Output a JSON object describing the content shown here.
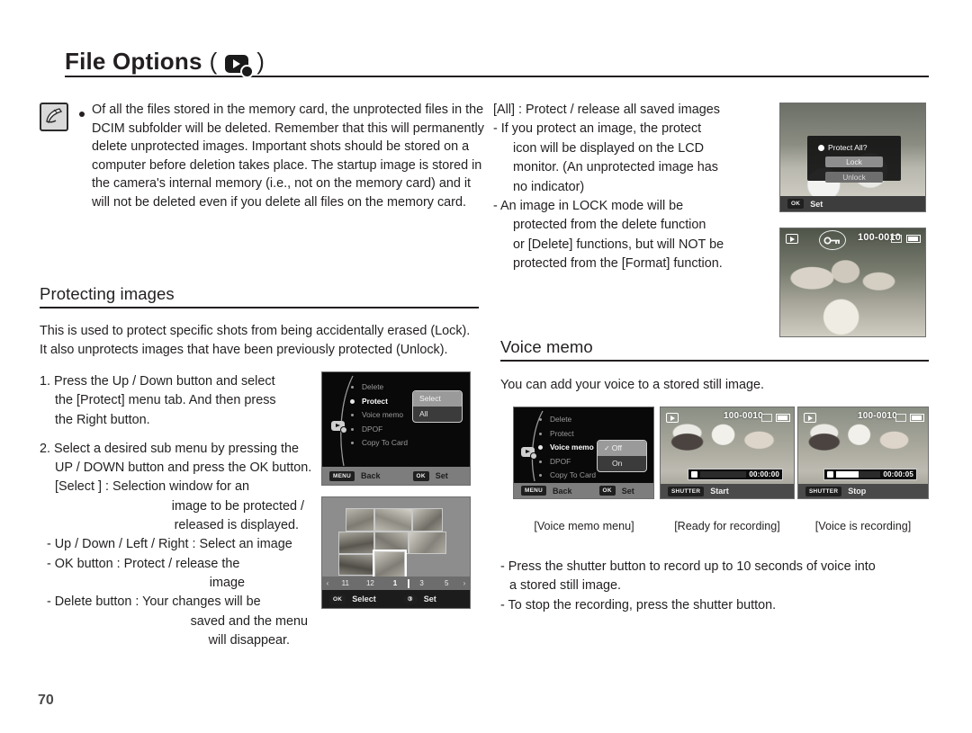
{
  "header": {
    "title": "File Options",
    "paren_open": "(",
    "paren_close": ")",
    "icon": "play-mode-icon"
  },
  "note": {
    "icon": "pen-note-icon",
    "bullet": "•",
    "text": "Of all the files stored in the memory card, the unprotected files in the DCIM subfolder will be deleted. Remember that this will permanently delete unprotected images. Important shots should be stored on a computer before deletion takes place. The startup image is stored in the camera's internal memory (i.e., not on the memory card) and it will not be deleted even if you delete all files on the memory card."
  },
  "right_notes": {
    "lines": [
      "[All] : Protect / release all saved images",
      "- If you protect an image, the protect",
      "icon will be displayed on the LCD",
      "monitor. (An unprotected image has",
      "no indicator)",
      "- An image in LOCK mode will be",
      "protected from the delete function",
      "or [Delete] functions, but will NOT be",
      "protected from the [Format] function."
    ]
  },
  "protecting_images": {
    "heading": "Protecting images",
    "intro_line_1": "This is used to protect specific shots from being accidentally erased (Lock).",
    "intro_line_2": "It also unprotects images that have been previously protected (Unlock).",
    "step1": [
      "1. Press the Up / Down button and select",
      "the [Protect] menu tab. And then press",
      "the Right button."
    ],
    "step2": [
      "2. Select a desired sub menu by pressing the",
      "UP / DOWN button and press the OK button.",
      "[Select ] : Selection window for an",
      "image to be protected /",
      "released is displayed.",
      "- Up / Down / Left / Right : Select an image",
      "- OK button : Protect / release the",
      "image",
      "- Delete button : Your changes will be",
      "saved and the menu",
      "will disappear."
    ]
  },
  "voice_memo": {
    "heading": "Voice memo",
    "intro": "You can add your voice to a stored still image.",
    "bullets": [
      "- Press the shutter button to record up to 10 seconds of voice into",
      "a stored still image.",
      "- To stop the recording, press the shutter button."
    ],
    "captions": [
      "[Voice memo menu]",
      "[Ready for recording]",
      "[Voice is recording]"
    ]
  },
  "lcd_protect_menu": {
    "items": [
      "Delete",
      "Protect",
      "Voice memo",
      "DPOF",
      "Copy To Card"
    ],
    "selected_index": 1,
    "submenu": [
      "Select",
      "All"
    ],
    "submenu_active_index": 0,
    "bar": {
      "left_key": "MENU",
      "left_label": "Back",
      "right_key": "OK",
      "right_label": "Set"
    },
    "mode_icon": "play-mode-icon"
  },
  "lcd_thumbnails": {
    "page_numbers": [
      "11",
      "12",
      "1",
      "3",
      "5"
    ],
    "current_page": "1",
    "arrow_left": "‹",
    "arrow_right": "›",
    "bar": {
      "left_key": "OK",
      "left_label": "Select",
      "right_key": "③",
      "right_label": "Set"
    }
  },
  "lcd_protect_all": {
    "title": "Protect All?",
    "buttons": [
      "Lock",
      "Unlock"
    ],
    "active_button_index": 0,
    "bar": {
      "left_key": "OK",
      "left_label": "Set"
    }
  },
  "lcd_protected_photo": {
    "file_number": "100-0010",
    "lock_icon": "key-protect-icon",
    "play_icon": "play-icon",
    "battery_icon": "battery-icon"
  },
  "lcd_voice_menu": {
    "items": [
      "Delete",
      "Protect",
      "Voice memo",
      "DPOF",
      "Copy To Card"
    ],
    "selected_index": 2,
    "submenu": [
      "Off",
      "On"
    ],
    "submenu_active_index": 0,
    "submenu_tick": "✓",
    "bar": {
      "left_key": "MENU",
      "left_label": "Back",
      "right_key": "OK",
      "right_label": "Set"
    },
    "mode_icon": "play-mode-icon"
  },
  "lcd_ready_recording": {
    "file_number": "100-0010",
    "timer": "00:00:00",
    "progress_percent": 0,
    "bar": {
      "key": "SHUTTER",
      "label": "Start"
    }
  },
  "lcd_is_recording": {
    "file_number": "100-0010",
    "timer": "00:00:05",
    "progress_percent": 50,
    "bar": {
      "key": "SHUTTER",
      "label": "Stop"
    }
  },
  "footer": {
    "page_number": "70"
  },
  "colors": {
    "text": "#231f20",
    "rule": "#231f20",
    "lcd_bg": "#0a0a0a",
    "lcd_bar": "#7d7d7d",
    "accent_white": "#ffffff"
  }
}
